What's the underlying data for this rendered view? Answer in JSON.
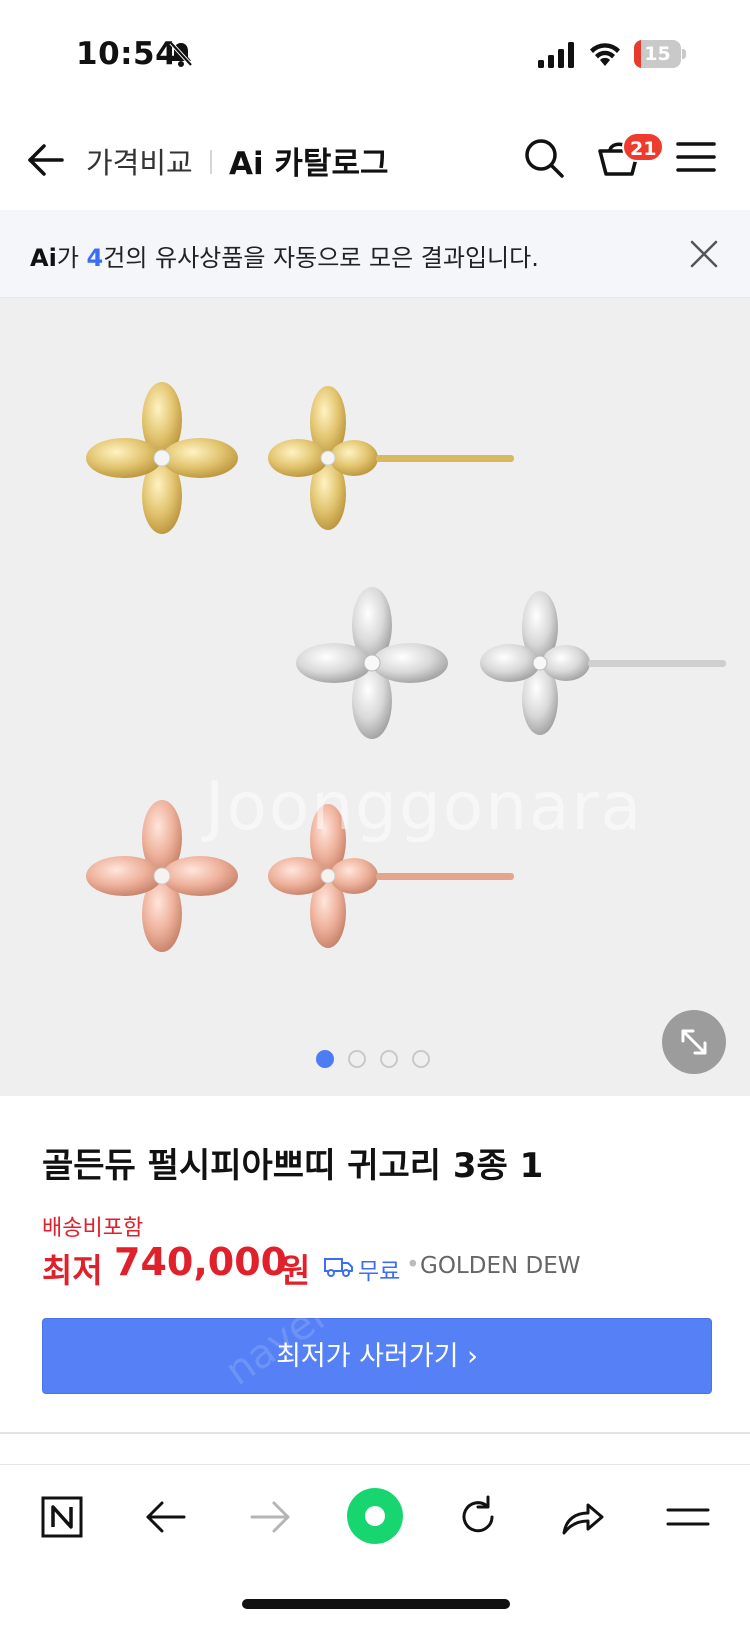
{
  "status_bar": {
    "time": "10:54",
    "battery": "15",
    "battery_level": 0.15,
    "icons": [
      "bell-slash-icon",
      "signal-icon",
      "wifi-icon",
      "battery-icon"
    ]
  },
  "header": {
    "title_primary": "가격비교",
    "title_secondary": "Ai 카탈로그",
    "cart_count": "21",
    "icons": [
      "back-arrow-icon",
      "search-icon",
      "cart-icon",
      "menu-icon"
    ]
  },
  "ai_notice": {
    "prefix": "Ai",
    "text_before": "가 ",
    "count": "4",
    "text_after": "건의 유사상품을 자동으로 모은 결과입니다."
  },
  "gallery": {
    "total_slides": 4,
    "active_slide": 1,
    "watermark": "Joonggonara",
    "image_alt": "earrings"
  },
  "product": {
    "title": "골든듀 펄시피아쁘띠 귀고리 3종 1",
    "shipping_note": "배송비포함",
    "price_prefix": "최저",
    "price": "740,000",
    "price_unit": "원",
    "shipping_free": "무료",
    "separator": "•",
    "seller": "GOLDEN DEW"
  },
  "actions": {
    "buy_button": "최저가 사러가기 ›",
    "buy_watermark": "naver"
  },
  "colors": {
    "accent_blue": "#5580f6",
    "price_red": "#e0202b",
    "badge_red": "#ef3b2d",
    "gold": "#e2c46f",
    "silver": "#d9d9d9",
    "rose": "#eeb19b"
  },
  "bottom_bar": {
    "icons": [
      "naver-n-icon",
      "back-icon",
      "forward-icon",
      "home-icon",
      "reload-icon",
      "share-icon",
      "menu-icon"
    ]
  }
}
